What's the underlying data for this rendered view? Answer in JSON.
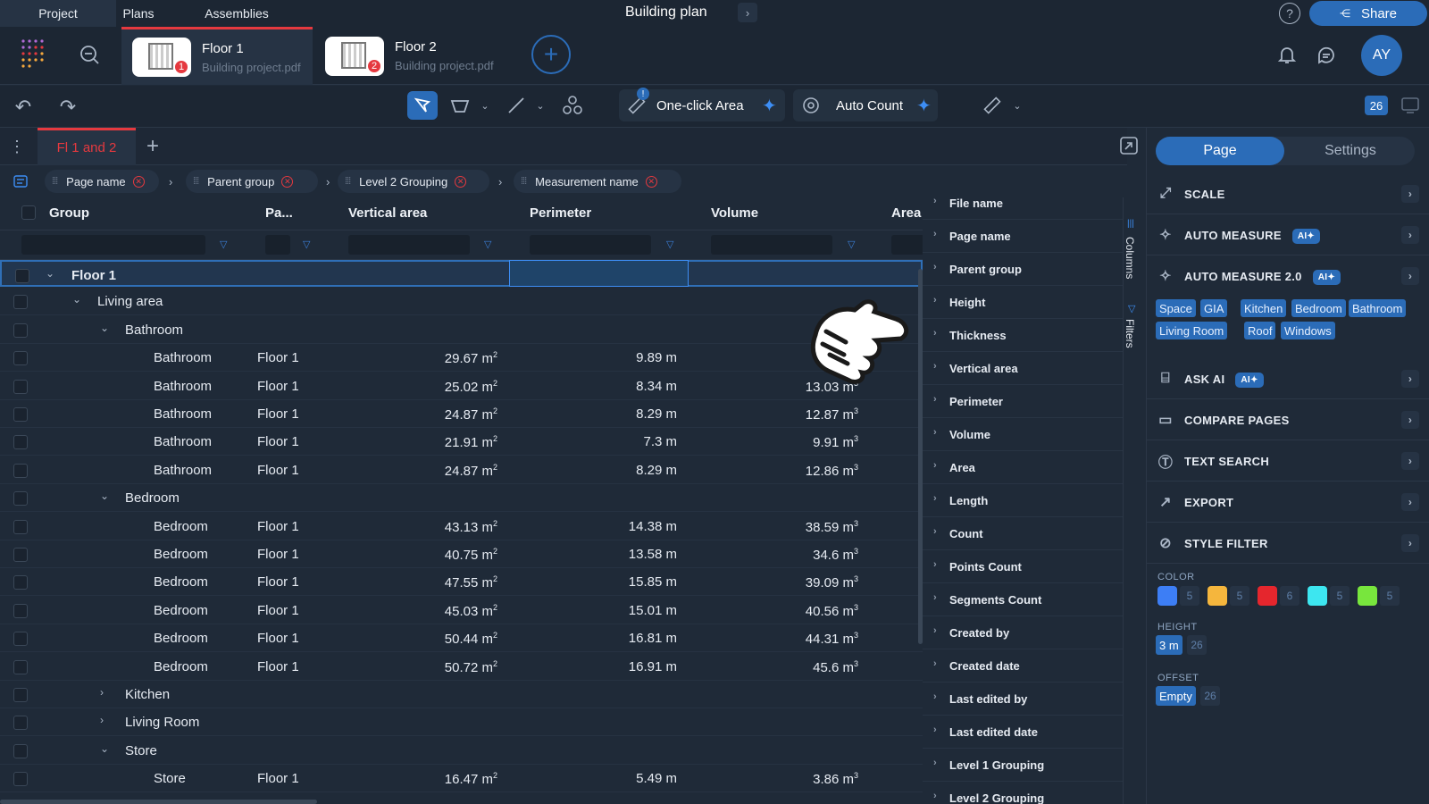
{
  "nav": {
    "tabs": [
      {
        "label": "Project"
      },
      {
        "label": "Plans"
      },
      {
        "label": "Assemblies"
      }
    ],
    "title": "Building plan",
    "share": "Share",
    "avatar": "AY"
  },
  "files": [
    {
      "name": "Floor 1",
      "sub": "Building project.pdf",
      "badge": "1"
    },
    {
      "name": "Floor 2",
      "sub": "Building project.pdf",
      "badge": "2"
    }
  ],
  "toolbar": {
    "one_click": "One-click Area",
    "auto_count": "Auto Count",
    "page_count": "26",
    "badge": "!"
  },
  "view_tab": {
    "label": "Fl 1 and 2"
  },
  "groupings": [
    {
      "label": "Page name"
    },
    {
      "label": "Parent group"
    },
    {
      "label": "Level 2 Grouping"
    },
    {
      "label": "Measurement name"
    }
  ],
  "columns": {
    "group": "Group",
    "page": "Pa...",
    "vertical_area": "Vertical area",
    "perimeter": "Perimeter",
    "volume": "Volume",
    "area": "Area"
  },
  "rows": [
    {
      "type": "g1",
      "name": "Floor 1"
    },
    {
      "type": "g2",
      "name": "Living area"
    },
    {
      "type": "g3",
      "name": "Bathroom"
    },
    {
      "type": "d",
      "name": "Bathroom",
      "page": "Floor 1",
      "va": "29.67 m",
      "pm": "9.89 m",
      "vol": "1"
    },
    {
      "type": "d",
      "name": "Bathroom",
      "page": "Floor 1",
      "va": "25.02 m",
      "pm": "8.34 m",
      "vol": "13.03 m"
    },
    {
      "type": "d",
      "name": "Bathroom",
      "page": "Floor 1",
      "va": "24.87 m",
      "pm": "8.29 m",
      "vol": "12.87 m"
    },
    {
      "type": "d",
      "name": "Bathroom",
      "page": "Floor 1",
      "va": "21.91 m",
      "pm": "7.3 m",
      "vol": "9.91 m"
    },
    {
      "type": "d",
      "name": "Bathroom",
      "page": "Floor 1",
      "va": "24.87 m",
      "pm": "8.29 m",
      "vol": "12.86 m"
    },
    {
      "type": "g3",
      "name": "Bedroom"
    },
    {
      "type": "d",
      "name": "Bedroom",
      "page": "Floor 1",
      "va": "43.13 m",
      "pm": "14.38 m",
      "vol": "38.59 m"
    },
    {
      "type": "d",
      "name": "Bedroom",
      "page": "Floor 1",
      "va": "40.75 m",
      "pm": "13.58 m",
      "vol": "34.6 m"
    },
    {
      "type": "d",
      "name": "Bedroom",
      "page": "Floor 1",
      "va": "47.55 m",
      "pm": "15.85 m",
      "vol": "39.09 m"
    },
    {
      "type": "d",
      "name": "Bedroom",
      "page": "Floor 1",
      "va": "45.03 m",
      "pm": "15.01 m",
      "vol": "40.56 m"
    },
    {
      "type": "d",
      "name": "Bedroom",
      "page": "Floor 1",
      "va": "50.44 m",
      "pm": "16.81 m",
      "vol": "44.31 m"
    },
    {
      "type": "d",
      "name": "Bedroom",
      "page": "Floor 1",
      "va": "50.72 m",
      "pm": "16.91 m",
      "vol": "45.6 m"
    },
    {
      "type": "g3c",
      "name": "Kitchen"
    },
    {
      "type": "g3c",
      "name": "Living Room"
    },
    {
      "type": "g3",
      "name": "Store"
    },
    {
      "type": "d",
      "name": "Store",
      "page": "Floor 1",
      "va": "16.47 m",
      "pm": "5.49 m",
      "vol": "3.86 m"
    }
  ],
  "column_list": [
    "File name",
    "Page name",
    "Parent group",
    "Height",
    "Thickness",
    "Vertical area",
    "Perimeter",
    "Volume",
    "Area",
    "Length",
    "Count",
    "Points Count",
    "Segments Count",
    "Created by",
    "Created date",
    "Last edited by",
    "Last edited date",
    "Level 1 Grouping",
    "Level 2 Grouping"
  ],
  "side_tabs": {
    "columns": "Columns",
    "filters": "Filters"
  },
  "panel": {
    "tab_page": "Page",
    "tab_settings": "Settings",
    "items": [
      {
        "label": "SCALE"
      },
      {
        "label": "AUTO MEASURE",
        "ai": "AI"
      },
      {
        "label": "AUTO MEASURE 2.0",
        "ai": "AI"
      },
      {
        "label": "ASK AI",
        "ai": "AI"
      },
      {
        "label": "COMPARE PAGES"
      },
      {
        "label": "TEXT SEARCH"
      },
      {
        "label": "EXPORT"
      },
      {
        "label": "STYLE FILTER"
      }
    ],
    "tags": [
      "Space",
      "GIA",
      "Kitchen",
      "Bedroom",
      "Bathroom",
      "Living Room",
      "Roof",
      "Windows"
    ],
    "color_label": "COLOR",
    "colors": [
      {
        "hex": "#3d7ef5",
        "count": "5"
      },
      {
        "hex": "#f5b63d",
        "count": "5"
      },
      {
        "hex": "#e5262d",
        "count": "6"
      },
      {
        "hex": "#3de6f0",
        "count": "5"
      },
      {
        "hex": "#78e63d",
        "count": "5"
      }
    ],
    "height_label": "HEIGHT",
    "height_value": "3 m",
    "height_count": "26",
    "offset_label": "OFFSET",
    "offset_value": "Empty",
    "offset_count": "26"
  }
}
